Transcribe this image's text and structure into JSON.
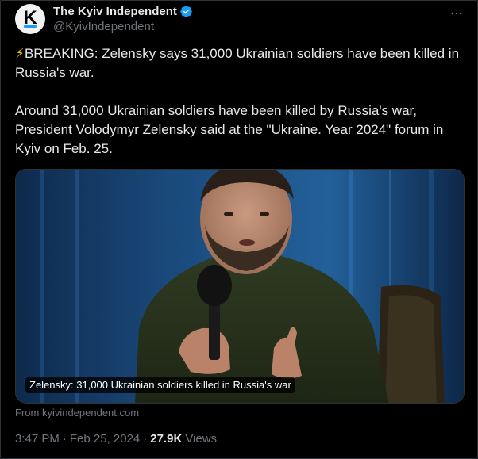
{
  "account": {
    "display_name": "The Kyiv Independent",
    "handle": "@KyivIndependent",
    "avatar_letter": "K",
    "verified": true
  },
  "tweet": {
    "breaking_icon": "⚡",
    "line1": "BREAKING: Zelensky says 31,000 Ukrainian soldiers have been killed in Russia's war.",
    "line2": "Around 31,000 Ukrainian soldiers have been killed by Russia's war, President Volodymyr Zelensky said at the \"Ukraine. Year 2024\" forum in Kyiv on Feb. 25."
  },
  "card": {
    "caption": "Zelensky: 31,000 Ukrainian soldiers killed in Russia's war",
    "source": "From kyivindependent.com"
  },
  "meta": {
    "time": "3:47 PM",
    "separator": "·",
    "date": "Feb 25, 2024",
    "views_count": "27.9K",
    "views_label": "Views"
  },
  "colors": {
    "background": "#000000",
    "text": "#e7e9ea",
    "muted": "#71767b",
    "accent": "#1d9bf0",
    "border": "#2f3336"
  },
  "icons": {
    "more": "more-horizontal-icon",
    "verified": "verified-badge-icon",
    "breaking": "lightning-icon"
  }
}
